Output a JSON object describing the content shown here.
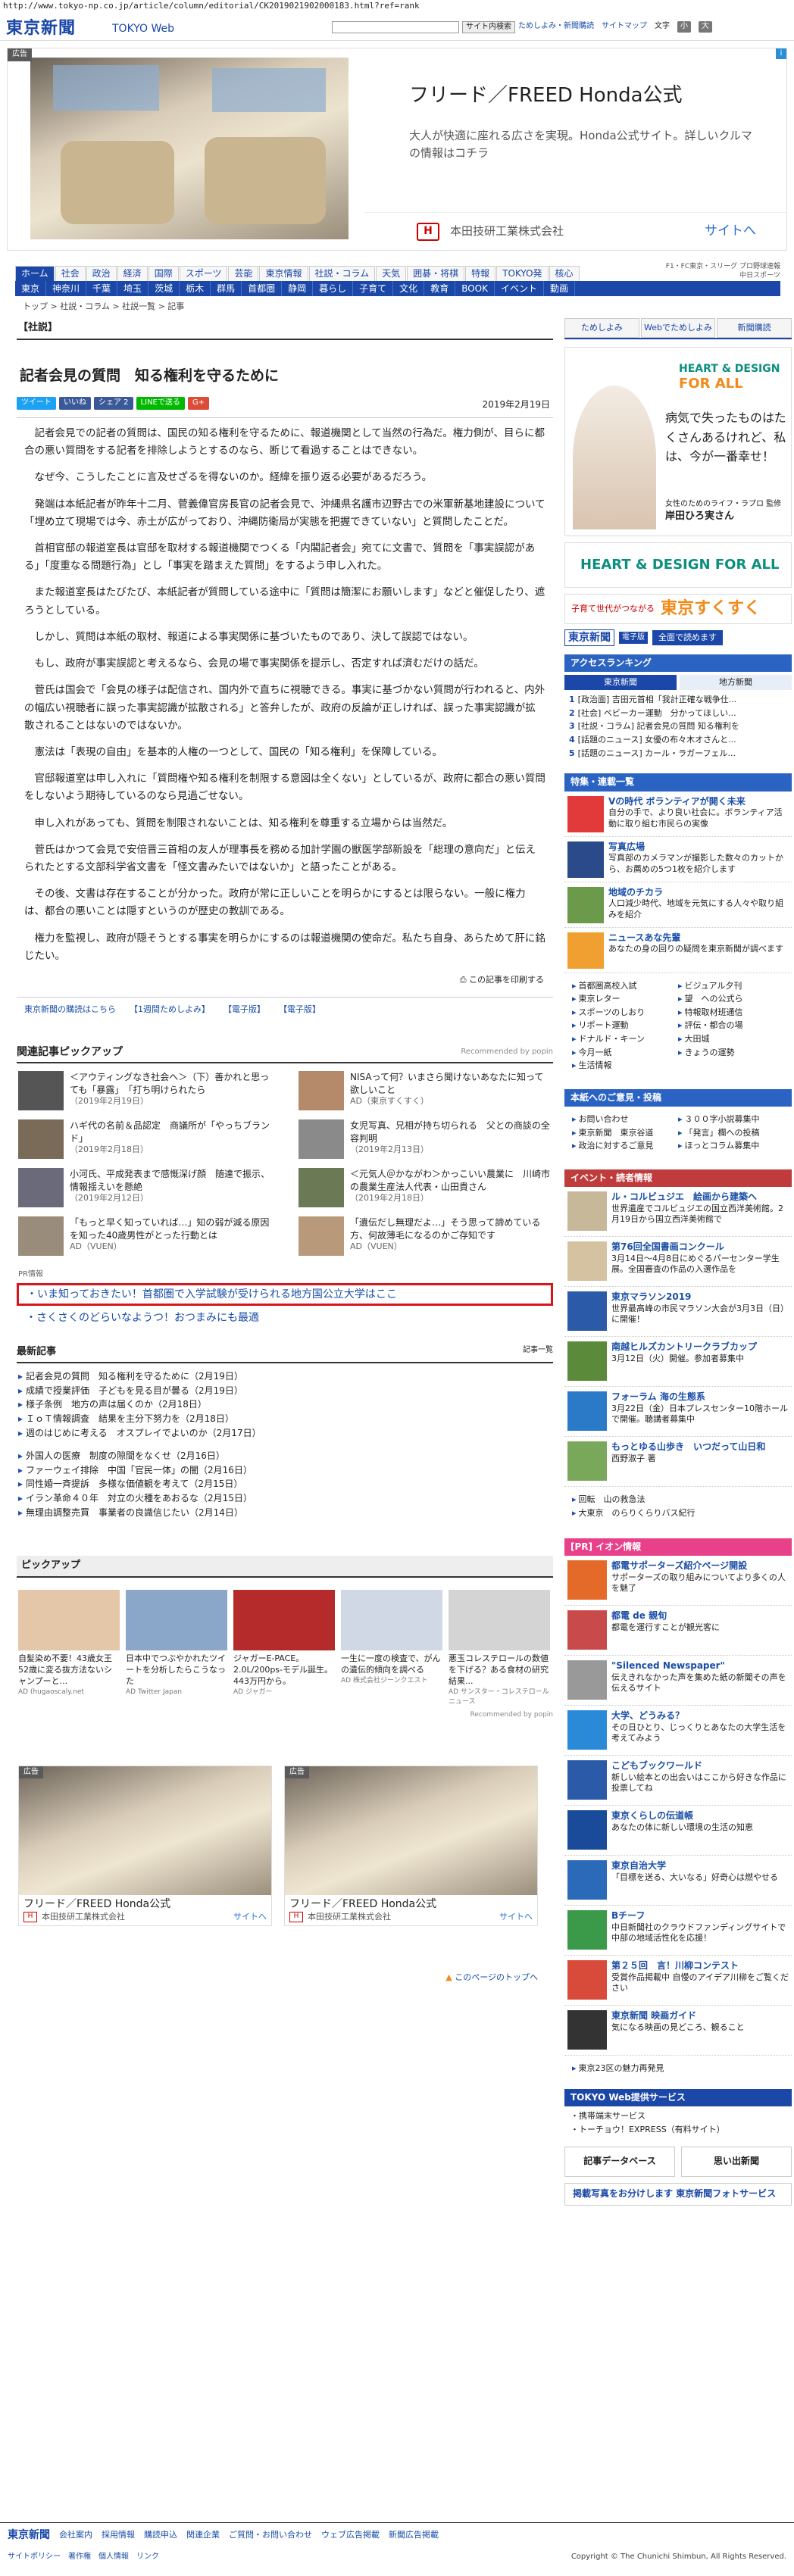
{
  "url": "http://www.tokyo-np.co.jp/article/column/editorial/CK2019021902000183.html?ref=rank",
  "header": {
    "logo": "東京新聞",
    "logo_sub": "TOKYO Web",
    "search_button": "サイト内検索",
    "links": [
      "ためしよみ・新聞購読",
      "サイトマップ"
    ],
    "font_label": "文字",
    "size_small": "小",
    "size_large": "大"
  },
  "banner": {
    "badge": "広告",
    "title": "フリード／FREED Honda公式",
    "desc": "大人が快適に座れる広さを実現。Honda公式サイト。詳しいクルマの情報はコチラ",
    "company": "本田技研工業株式会社",
    "link": "サイトへ"
  },
  "nav1": [
    "ホーム",
    "社会",
    "政治",
    "経済",
    "国際",
    "スポーツ",
    "芸能",
    "東京情報",
    "社説・コラム",
    "天気",
    "囲碁・将棋",
    "特報",
    "TOKYO発",
    "核心"
  ],
  "nav1_right": [
    "F1・FC東京・スリーグ プロ野球速報",
    "中日スポーツ"
  ],
  "nav2": [
    "東京",
    "神奈川",
    "千葉",
    "埼玉",
    "茨城",
    "栃木",
    "群馬",
    "首都圏",
    "静岡",
    "暮らし",
    "子育て",
    "文化",
    "教育",
    "BOOK",
    "イベント",
    "動画"
  ],
  "breadcrumb": "トップ > 社説・コラム > 社説一覧 > 記事",
  "article": {
    "section": "【社説】",
    "title": "記者会見の質問　知る権利を守るために",
    "share": [
      "ツイート",
      "いいね",
      "シェア 2",
      "LINEで送る",
      "G+"
    ],
    "date": "2019年2月19日",
    "paragraphs": [
      "記者会見での記者の質問は、国民の知る権利を守るために、報道機関として当然の行為だ。権力側が、目らに都合の悪い質問をする記者を排除しようとするのなら、断じて看過することはできない。",
      "なぜ今、こうしたことに言及せざるを得ないのか。経緯を振り返る必要があるだろう。",
      "発端は本紙記者が昨年十二月、菅義偉官房長官の記者会見で、沖縄県名護市辺野古での米軍新基地建設について「埋め立て現場では今、赤土が広がっており、沖縄防衛局が実態を把握できていない」と質問したことだ。",
      "首相官邸の報道室長は官邸を取材する報道機関でつくる「内閣記者会」宛てに文書で、質問を「事実誤認がある」「度重なる問題行為」とし「事実を踏まえた質問」をするよう申し入れた。",
      "また報道室長はたびたび、本紙記者が質問している途中に「質問は簡潔にお願いします」などと催促したり、遮ろうとしている。",
      "しかし、質問は本紙の取材、報道による事実関係に基づいたものであり、決して誤認ではない。",
      "もし、政府が事実誤認と考えるなら、会見の場で事実関係を提示し、否定すれば済むだけの話だ。",
      "菅氏は国会で「会見の様子は配信され、国内外で直ちに視聴できる。事実に基づかない質問が行われると、内外の幅広い視聴者に誤った事実認識が拡散される」と答弁したが、政府の反論が正しければ、誤った事実認識が拡散されることはないのではないか。",
      "憲法は「表現の自由」を基本的人権の一つとして、国民の「知る権利」を保障している。",
      "官邸報道室は申し入れに「質問権や知る権利を制限する意図は全くない」としているが、政府に都合の悪い質問をしないよう期待しているのなら見過ごせない。",
      "申し入れがあっても、質問を制限されないことは、知る権利を尊重する立場からは当然だ。",
      "菅氏はかつて会見で安倍晋三首相の友人が理事長を務める加計学園の獣医学部新設を「総理の意向だ」と伝えられたとする文部科学省文書を「怪文書みたいではないか」と語ったことがある。",
      "その後、文書は存在することが分かった。政府が常に正しいことを明らかにするとは限らない。一般に権力は、都合の悪いことは隠すというのが歴史の教訓である。",
      "権力を監視し、政府が隠そうとする事実を明らかにするのは報道機関の使命だ。私たち自身、あらためて肝に銘じたい。"
    ],
    "print": "この記事を印刷する",
    "subs": [
      "東京新聞の購読はこちら",
      "【1週間ためしよみ】",
      "【電子版】",
      "【電子版】"
    ]
  },
  "related": {
    "title": "関連記事ピックアップ",
    "recommended": "Recommended by popin",
    "items": [
      {
        "text": "＜アウティングなき社会へ＞（下）善かれと思っても「暴露」　「打ち明けられたら",
        "date": "（2019年2月19日）"
      },
      {
        "text": "NISAって何？いまさら聞けないあなたに知って欲しいこと",
        "date": "AD（東京すくすく）"
      },
      {
        "text": "ハギ代の名前＆品認定　商議所が「やっちブランド」",
        "date": "（2019年2月18日）"
      },
      {
        "text": "女児写真、兄相が持ち切られる　父との商談の全容判明",
        "date": "（2019年2月13日）"
      },
      {
        "text": "小河氏、平成発表まで感慨深げ顔　随達で振示、情報揺えいを懸絶",
        "date": "（2019年2月12日）"
      },
      {
        "text": "＜元気人＠かながわ＞かっこいい農業に　川崎市の農業生産法人代表・山田貴さん",
        "date": "（2019年2月18日）"
      },
      {
        "text": "「もっと早く知っていれば…」知の弱が減る原因を知った40歳男性がとった行動とは",
        "date": "AD（VUEN）"
      },
      {
        "text": "「遺伝だし無理だよ…」そう思って諦めている方、何故薄毛になるのかご存知です",
        "date": "AD（VUEN）"
      }
    ]
  },
  "pr": {
    "label": "PR情報",
    "highlight": "いま知っておきたい！首都圏で入学試験が受けられる地方国公立大学はここ",
    "line": "さくさくのどらいなようつ！おつまみにも最適"
  },
  "latest": {
    "title": "最新記事",
    "list_label": "記事一覧",
    "group1": [
      "記者会見の質問　知る権利を守るために（2月19日）",
      "成績で授業評価　子どもを見る目が曇る（2月19日）",
      "様子条例　地方の声は届くのか（2月18日）",
      "ＩｏＴ情報調査　結果を主分下努力を（2月18日）",
      "週のはじめに考える　オスプレイでよいのか（2月17日）"
    ],
    "group2": [
      "外国人の医療　制度の隙間をなくせ（2月16日）",
      "ファーウェイ排除　中国「官民一体」の闇（2月16日）",
      "同性婚一斉提訴　多様な価値観を考えて（2月15日）",
      "イラン革命４０年　対立の火種をあおるな（2月15日）",
      "無理由調整売買　事業者の良識信じたい（2月14日）"
    ]
  },
  "pickup": {
    "title": "ピックアップ",
    "items": [
      {
        "text": "自髪染め不要！43歳女王52歳に変る抜方法ないシャンプーと...",
        "src": "AD (hugaoscaly.net"
      },
      {
        "text": "日本中でつぶやかれたツイートを分析したらこうなった",
        "src": "AD Twitter Japan"
      },
      {
        "text": "ジャガーE-PACE。2.0L/200ps-モデル誕生。443万円から。",
        "src": "AD ジャガー"
      },
      {
        "text": "一生に一度の検査で、がんの遺伝的傾向を調べる",
        "src": "AD 株式会社ジーンクエスト"
      },
      {
        "text": "悪玉コレステロールの数値を下げる？ある食材の研究結果...",
        "src": "AD サンスター・コレステロールニュース"
      }
    ],
    "recommended": "Recommended by popin"
  },
  "ad2": {
    "badge": "広告",
    "caption": "フリード／FREED Honda公式",
    "company": "本田技研工業株式会社",
    "link": "サイトへ"
  },
  "pagetop": "このページのトップへ",
  "side": {
    "tabs": [
      "ためしよみ",
      "Webでためしよみ",
      "新聞購読"
    ],
    "ad": {
      "head1": "HEART & DESIGN",
      "head2": "FOR ALL",
      "quote": "病気で失ったものはたくさんあるけれど、私は、今が一番幸せ！",
      "org": "女性のためのライフ・ラプロ 監修",
      "name": "岸田ひろ実さん"
    },
    "banner2": "HEART & DESIGN FOR ALL",
    "sukusuku_left": "子育て世代がつながる",
    "sukusuku_brand": "東京すくすく",
    "esearch_logo": "東京新聞",
    "esearch_tag": "電子版",
    "esearch_btn": "全面で読めます",
    "ranking": {
      "title": "アクセスランキング",
      "tabs": [
        "東京新聞",
        "地方新聞"
      ],
      "items": [
        {
          "n": "1",
          "t": "[政治面] 吉田元首相「我計正確な戦争仕..."
        },
        {
          "n": "2",
          "t": "[社会] ベビーカー運動　分かってほしい..."
        },
        {
          "n": "3",
          "t": "[社説・コラム] 記者会見の質問 知る権利を"
        },
        {
          "n": "4",
          "t": "[話題のニュース] 女優の布々木オさんと..."
        },
        {
          "n": "5",
          "t": "[話題のニュース] カール・ラガーフェル..."
        }
      ]
    },
    "features_title": "特集・連載一覧",
    "features": [
      {
        "t": "Vの時代 ボランティアが開く未来",
        "d": "自分の手で、より良い社会に。ボランティア活動に取り組む市民らの実像"
      },
      {
        "t": "写真広場",
        "d": "写真部のカメラマンが撮影した数々のカットから、お薦めの5つ1枚を紹介します"
      },
      {
        "t": "地域のチカラ",
        "d": "人口減少時代、地域を元気にする人々や取り組みを紹介"
      },
      {
        "t": "ニュースあな先輩",
        "d": "あなたの身の回りの疑問を東京新聞が調べます"
      }
    ],
    "links": [
      "首都圏高校入試",
      "ビジュアル夕刊",
      "東京レター",
      "望　への公式ら",
      "スポーツのしおり",
      "特報取材班通信",
      "リポート運動",
      "評伝・都合の場",
      "ドナルド・キーン",
      "大田城",
      "今月一紙",
      "きょうの運勢",
      "生活情報"
    ],
    "services_title": "本紙へのご意見・投稿",
    "services": [
      "お問い合わせ",
      "３００字小説募集中",
      "東京新聞　東京谷道",
      "「発言」欄への投稿",
      "政治に対するご意見",
      "ほっとコラム募集中"
    ],
    "events_title": "イベント・読者情報",
    "events": [
      {
        "t": "ル・コルビュジエ　絵画から建築へ",
        "d": "世界遺産でコルビュジエの国立西洋美術館。2月19日から国立西洋美術館で"
      },
      {
        "t": "第76回全国書画コンクール",
        "d": "3月14日～4月8日にめぐるパーセンター学生展。全国審査の作品の入選作品を"
      },
      {
        "t": "東京マラソン2019",
        "d": "世界最高峰の市民マラソン大会が3月3日（日）に開催！"
      },
      {
        "t": "南越ヒルズカントリークラブカップ",
        "d": "3月12日（火）開催。参加者募集中"
      },
      {
        "t": "フォーラム 海の生態系",
        "d": "3月22日（金）日本プレスセンター10階ホールで開催。聴講者募集中"
      },
      {
        "t": "もっとゆる山歩き　いつだって山日和",
        "d": "西野淑子 著"
      }
    ],
    "misc_links": [
      "回転　山の救急法",
      "大東京　のらりくらりバス紀行"
    ],
    "aeon_title": "[PR] イオン情報",
    "aeon": [
      {
        "t": "都電サポーターズ紹介ページ開設",
        "d": "サポーターズの取り組みについてより多くの人を魅了"
      },
      {
        "t": "都電 de 親旬",
        "d": "都電を運行すことが観光客に"
      },
      {
        "t": "\"Silenced Newspaper\"",
        "d": "伝えきれなかった声を集めた紙の新聞その声を伝えるサイト"
      },
      {
        "t": "大学、どうみる？",
        "d": "その日ひとり、じっくりとあなたの大学生活を考えてみよう"
      },
      {
        "t": "こどもブックワールド",
        "d": "新しい絵本との出会いはここから好きな作品に投票してね"
      },
      {
        "t": "東京くらしの伝道帳",
        "d": "あなたの体に新しい環境の生活の知恵"
      },
      {
        "t": "東京自治大学",
        "d": "「目標を送る、大いなる」好奇心は燃やせる"
      },
      {
        "t": "Bチーフ",
        "d": "中日新聞社のクラウドファンディングサイトで中部の地域活性化を応援！"
      },
      {
        "t": "第２５回　言！川柳コンテスト",
        "d": "受賞作品掲載中 自慢のアイデア川柳をご覧ください"
      },
      {
        "t": "東京新聞 映画ガイド",
        "d": "気になる映画の見どころ、観ること"
      }
    ],
    "shop": "東京23区の魅力再発見",
    "service_title": "TOKYO Web提供サービス",
    "service_links": [
      "携帯端末サービス",
      "トーチョウ！EXPRESS（有料サイト）"
    ],
    "btn1": "記事データベース",
    "btn2": "思い出新聞",
    "photo": "掲載写真をお分けします 東京新聞フォトサービス"
  },
  "footer": {
    "logo": "東京新聞",
    "links": [
      "会社案内",
      "採用情報",
      "購読申込",
      "関連企業",
      "ご質問・お問い合わせ",
      "ウェブ広告掲載",
      "新聞広告掲載"
    ],
    "bottom_links": [
      "サイトポリシー",
      "著作権",
      "個人情報",
      "リンク"
    ],
    "copyright": "Copyright © The Chunichi Shimbun, All Rights Reserved."
  }
}
